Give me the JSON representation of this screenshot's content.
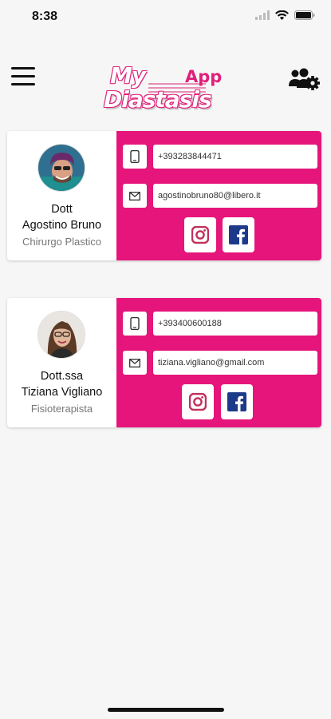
{
  "status": {
    "time": "8:38"
  },
  "header": {
    "logo_my": "My",
    "logo_app": "App",
    "logo_diastasis": "Diastasis"
  },
  "colors": {
    "accent": "#e5157b",
    "instagram": "#c1305c",
    "facebook": "#1d3a8a"
  },
  "icons": {
    "menu": "hamburger-menu-icon",
    "users": "users-gear-icon",
    "phone": "mobile-phone-icon",
    "email": "envelope-icon",
    "instagram": "instagram-icon",
    "facebook": "facebook-icon"
  },
  "contacts": [
    {
      "title_line1": "Dott",
      "title_line2": "Agostino Bruno",
      "role": "Chirurgo Plastico",
      "phone": "+393283844471",
      "email": "agostinobruno80@libero.it"
    },
    {
      "title_line1": "Dott.ssa",
      "title_line2": "Tiziana Vigliano",
      "role": "Fisioterapista",
      "phone": "+393400600188",
      "email": "tiziana.vigliano@gmail.com"
    }
  ]
}
